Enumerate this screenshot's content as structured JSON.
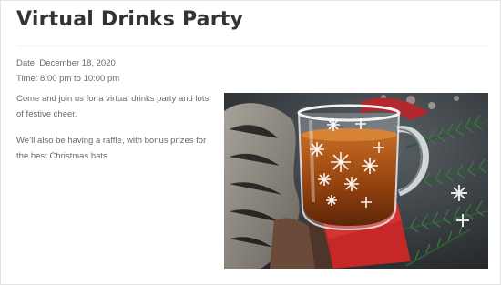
{
  "event": {
    "title": "Virtual Drinks Party",
    "date": "Date: December 18, 2020",
    "time": "Time: 8:00 pm to 10:00 pm",
    "paragraphs": [
      "Come and join us for a virtual drinks party and lots of festive cheer.",
      "We’ll also be having a raffle, with bonus prizes for the best Christmas hats."
    ]
  },
  "image": {
    "subject": "glass-mug-of-tea-with-snowflakes",
    "colors": {
      "background": "#3a3f44",
      "tea": "#a0521a",
      "napkin": "#c62828",
      "scarf": "#8a8680",
      "fir": "#2f5a34"
    }
  }
}
